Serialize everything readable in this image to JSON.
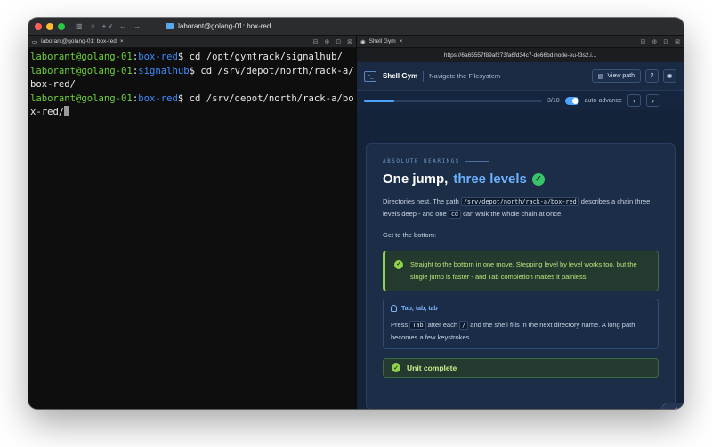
{
  "titlebar": {
    "icons": [
      "sidebar-icon",
      "bell-icon",
      "plus-icon",
      "back-icon",
      "forward-icon"
    ],
    "title": "laborant@golang-01: box-red"
  },
  "terminal": {
    "tab_label": "laborant@golang-01: box-red",
    "lines": [
      {
        "user": "laborant@golang-01",
        "dir": "box-red",
        "cmd": "$ cd /opt/gymtrack/signalhub/"
      },
      {
        "user": "laborant@golang-01",
        "dir": "signalhub",
        "cmd": "$ cd /srv/depot/north/rack-a/box-red/"
      },
      {
        "user": "laborant@golang-01",
        "dir": "box-red",
        "cmd": "$ cd /srv/depot/north/rack-a/box-red/"
      }
    ]
  },
  "browser": {
    "tab_label": "Shell Gym",
    "url": "https://6a65557f89af273fa6fd34c7-de66bd.node-eu-f3s2.i..."
  },
  "app": {
    "brand": "Shell Gym",
    "subtitle": "Navigate the Filesystem",
    "view_path": "View path",
    "progress_text": "3/18",
    "progress_fraction": 0.17,
    "auto_advance": "auto-advance",
    "prev": "‹",
    "next": "›"
  },
  "card": {
    "eyebrow": "ABSOLUTE BEARINGS",
    "title_main": "One jump,",
    "title_accent": "three levels",
    "para1_a": "Directories nest. The path",
    "para1_code": "/srv/depot/north/rack-a/box-red",
    "para1_b": "describes a chain three levels deep - and one",
    "para1_code2": "cd",
    "para1_c": "can walk the whole chain at once.",
    "para2": "Get to the bottom:",
    "success": "Straight to the bottom in one move. Stepping level by level works too, but the single jump is faster - and Tab completion makes it painless.",
    "tip_title": "Tab, tab, tab",
    "tip_a": "Press",
    "tip_code1": "Tab",
    "tip_b": "after each",
    "tip_code2": "/",
    "tip_c": "and the shell fills in the next directory name. A long path becomes a few keystrokes.",
    "complete": "Unit complete"
  },
  "debug": {
    "label": "debug"
  },
  "colors": {
    "user": "#6fcf3b",
    "dir": "#3f8cff",
    "accent": "#4da3ff",
    "success": "#8fd24b"
  }
}
